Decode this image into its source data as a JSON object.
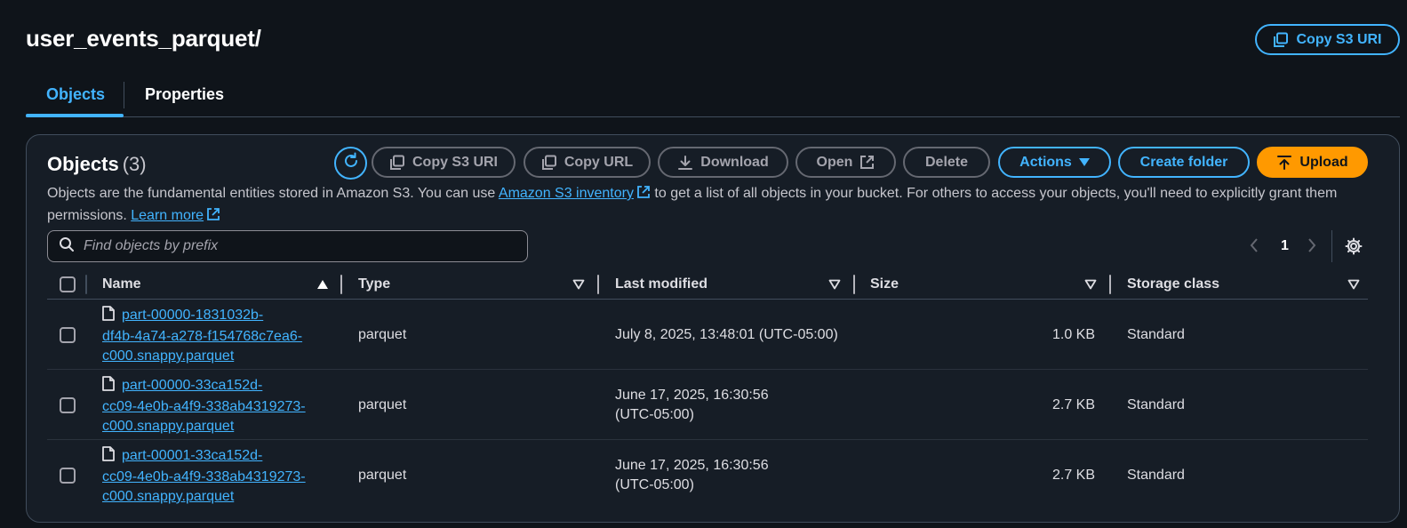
{
  "page": {
    "title": "user_events_parquet/",
    "copy_s3_uri": "Copy S3 URI"
  },
  "tabs": [
    {
      "label": "Objects"
    },
    {
      "label": "Properties"
    }
  ],
  "objects_panel": {
    "title": "Objects",
    "count": "(3)",
    "description_before": "Objects are the fundamental entities stored in Amazon S3. You can use ",
    "inventory_link": "Amazon S3 inventory",
    "description_after": " to get a list of all objects in your bucket. For others to access your objects, you'll need to explicitly grant them permissions. ",
    "learn_more": "Learn more",
    "toolbar": {
      "copy_s3_uri": "Copy S3 URI",
      "copy_url": "Copy URL",
      "download": "Download",
      "open": "Open",
      "delete": "Delete",
      "actions": "Actions",
      "create_folder": "Create folder",
      "upload": "Upload"
    },
    "search": {
      "placeholder": "Find objects by prefix"
    },
    "pagination": {
      "current_page": "1"
    },
    "columns": [
      "Name",
      "Type",
      "Last modified",
      "Size",
      "Storage class"
    ],
    "rows": [
      {
        "name_lines": [
          "part-00000-1831032b-",
          "df4b-4a74-a278-f154768c7ea6-",
          "c000.snappy.parquet"
        ],
        "type": "parquet",
        "modified_lines": [
          "July 8, 2025, 13:48:01 (UTC-05:00)"
        ],
        "size": "1.0 KB",
        "storage_class": "Standard"
      },
      {
        "name_lines": [
          "part-00000-33ca152d-",
          "cc09-4e0b-a4f9-338ab4319273-",
          "c000.snappy.parquet"
        ],
        "type": "parquet",
        "modified_lines": [
          "June 17, 2025, 16:30:56",
          "(UTC-05:00)"
        ],
        "size": "2.7 KB",
        "storage_class": "Standard"
      },
      {
        "name_lines": [
          "part-00001-33ca152d-",
          "cc09-4e0b-a4f9-338ab4319273-",
          "c000.snappy.parquet"
        ],
        "type": "parquet",
        "modified_lines": [
          "June 17, 2025, 16:30:56",
          "(UTC-05:00)"
        ],
        "size": "2.7 KB",
        "storage_class": "Standard"
      }
    ]
  },
  "colors": {
    "background": "#0f141a",
    "panel": "#161d26",
    "link_blue": "#42b4ff",
    "upload_orange": "#ff9900",
    "border": "#414d5c"
  },
  "icons": [
    "copy-icon",
    "refresh-icon",
    "download-icon",
    "external-link-icon",
    "caret-down-icon",
    "upload-icon",
    "search-icon",
    "chevron-left-icon",
    "chevron-right-icon",
    "gear-icon",
    "file-icon",
    "sort-asc-icon",
    "sort-desc-icon"
  ]
}
